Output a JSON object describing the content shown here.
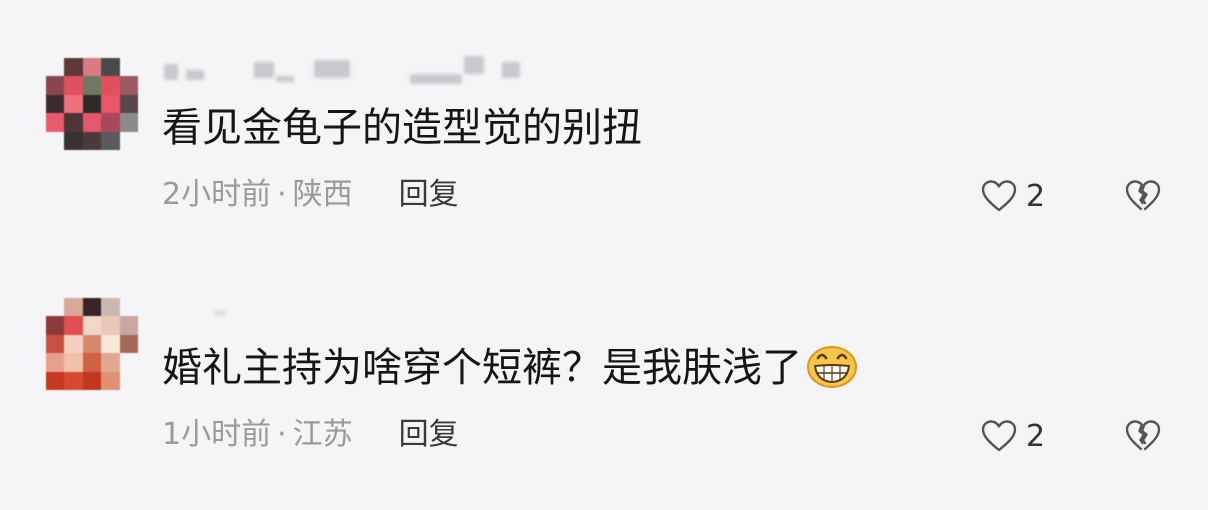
{
  "comments": [
    {
      "avatar": {
        "pixels": [
          [
            "#f5f5f7",
            "#5c3a3a",
            "#d97a85",
            "#4a4a48",
            "#f5f5f7"
          ],
          [
            "#8a4650",
            "#e0505f",
            "#6e7a60",
            "#e0505f",
            "#9a5a60"
          ],
          [
            "#3c2c30",
            "#f07080",
            "#2a2a2a",
            "#e85566",
            "#5a4648"
          ],
          [
            "#e85a6c",
            "#4e3436",
            "#e8566a",
            "#a8485a",
            "#8a8a88"
          ],
          [
            "#f5f5f7",
            "#3a3232",
            "#4a3a3c",
            "#5a5a5a",
            "#f5f5f7"
          ]
        ]
      },
      "content": "看见金龟子的造型觉的别扭",
      "time": "2小时前",
      "separator": "·",
      "location": "陕西",
      "reply_label": "回复",
      "like_count": "2",
      "like_icon": "heart-outline-icon",
      "dislike_icon": "broken-heart-icon"
    },
    {
      "avatar": {
        "pixels": [
          [
            "#f5f5f7",
            "#d8a898",
            "#3a2426",
            "#c8b8b0",
            "#f5f5f7"
          ],
          [
            "#8a3a3a",
            "#e05050",
            "#f0d8c8",
            "#e8c8b8",
            "#c8a8a0"
          ],
          [
            "#c85040",
            "#f2d0c0",
            "#d88868",
            "#f8e8dc",
            "#a86858"
          ],
          [
            "#e8a088",
            "#f0c0a8",
            "#d06040",
            "#e0a890",
            "#f5f5f7"
          ],
          [
            "#c83820",
            "#d84830",
            "#c03820",
            "#e09070",
            "#f5f5f7"
          ]
        ]
      },
      "content": "婚礼主持为啥穿个短裤？是我肤浅了",
      "content_emoji": "grinning-face-emoji",
      "time": "1小时前",
      "separator": "·",
      "location": "江苏",
      "reply_label": "回复",
      "like_count": "2",
      "like_icon": "heart-outline-icon",
      "dislike_icon": "broken-heart-icon"
    }
  ]
}
